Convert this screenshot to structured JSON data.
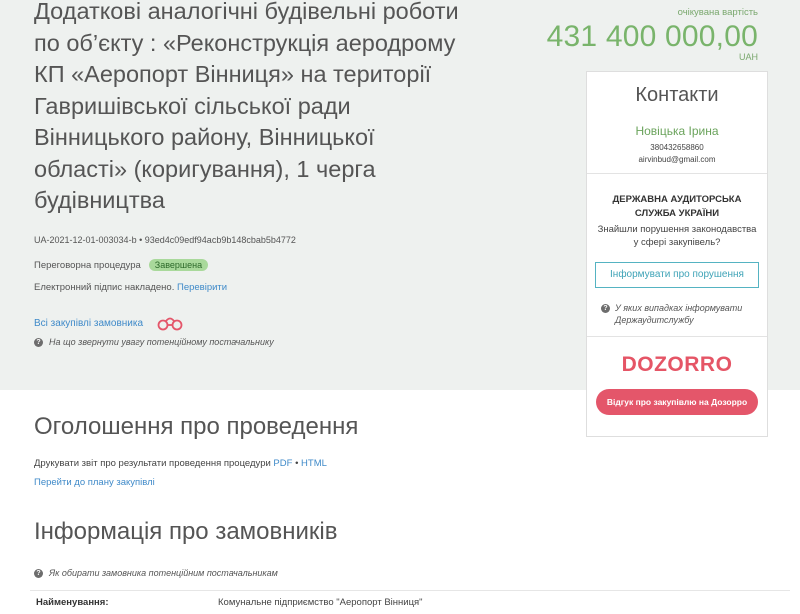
{
  "tender": {
    "title": "Додаткові аналогічні будівельні роботи по об’єкту : «Реконструкція аеродрому КП «Аеропорт Вінниця» на території Гавришівської сільської ради Вінницького району, Вінницької області» (коригування), 1 черга будівництва",
    "id": "UA-2021-12-01-003034-b",
    "hash": "93ed4c09edf94acb9b148cbab5b4772",
    "procedure": "Переговорна процедура",
    "status": "Завершена",
    "signature_text": "Електронний підпис накладено.",
    "signature_link": "Перевірити",
    "all_purchases_link": "Всі закупівлі замовника",
    "supplier_note": "На що звернути увагу потенційному постачальнику"
  },
  "expected": {
    "label": "очікувана вартість",
    "value": "431 400 000,00",
    "currency": "UAH"
  },
  "contacts": {
    "title": "Контакти",
    "name": "Новіцька Ірина",
    "phone": "380432658860",
    "email": "airvinbud@gmail.com",
    "audit_title": "ДЕРЖАВНА АУДИТОРСЬКА СЛУЖБА УКРАЇНИ",
    "audit_found": "Знайшли порушення законодавства у сфері закупівель?",
    "report_button": "Інформувати про порушення",
    "audit_note": "У яких випадках інформувати Держаудитслужбу",
    "dozorro_logo": "DOZORRO",
    "dozorro_button": "Відгук про закупівлю на Дозорро"
  },
  "announcement": {
    "heading": "Оголошення про проведення",
    "print_text": "Друкувати звіт про результати проведення процедури",
    "pdf_link": "PDF",
    "separator": "•",
    "html_link": "HTML",
    "plan_link": "Перейти до плану закупівлі"
  },
  "customers": {
    "heading": "Інформація про замовників",
    "how_note": "Як обирати замовника потенційним постачальникам",
    "name_label": "Найменування:",
    "name_value": "Комунальне підприємство \"Аеропорт Вінниця\""
  },
  "colors": {
    "accent_green": "#79b46b",
    "link_blue": "#3f8ac9",
    "dozorro_red": "#e4566a",
    "header_bg": "#eef1ef"
  }
}
